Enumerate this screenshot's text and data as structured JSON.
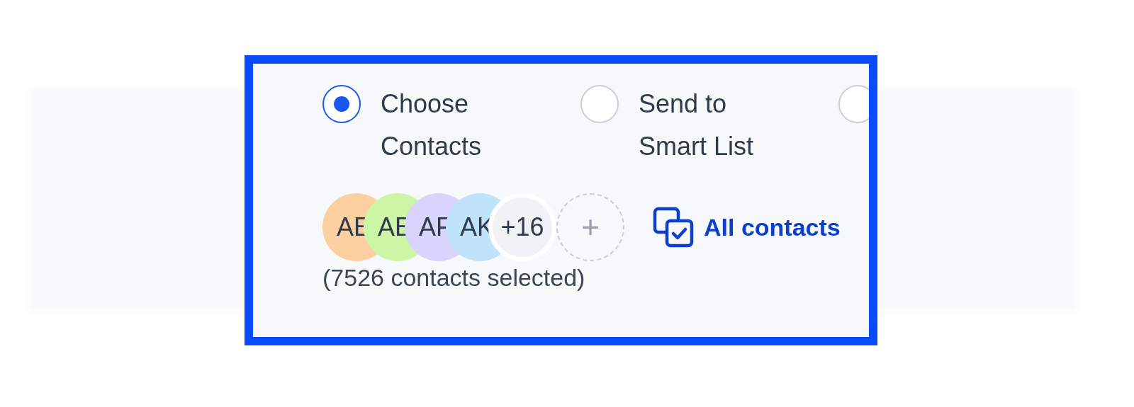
{
  "options": [
    {
      "label": "Choose Contacts",
      "selected": true
    },
    {
      "label": "Send to Smart List",
      "selected": false
    },
    {
      "selected": false
    }
  ],
  "avatars": [
    {
      "initials": "AE",
      "color": "#fbcfa0"
    },
    {
      "initials": "AE",
      "color": "#ccf5a6"
    },
    {
      "initials": "AF",
      "color": "#d8d4fb"
    },
    {
      "initials": "AK",
      "color": "#bfe3fb"
    }
  ],
  "more_count": "+16",
  "add_button": "+",
  "all_contacts_link": "All contacts",
  "selection_summary": "(7526 contacts selected)"
}
